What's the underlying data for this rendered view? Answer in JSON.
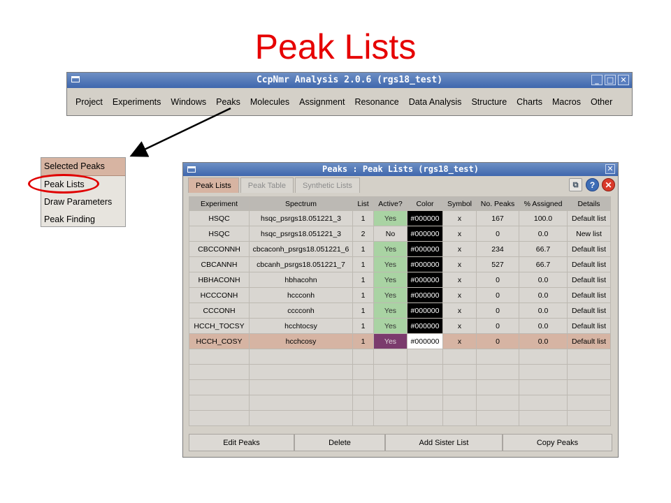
{
  "slide": {
    "title": "Peak Lists"
  },
  "main_window": {
    "title": "CcpNmr Analysis 2.0.6 (rgs18_test)",
    "menu": [
      "Project",
      "Experiments",
      "Windows",
      "Peaks",
      "Molecules",
      "Assignment",
      "Resonance",
      "Data Analysis",
      "Structure",
      "Charts",
      "Macros",
      "Other"
    ]
  },
  "peaks_menu": {
    "items": [
      "Selected Peaks",
      "Peak Lists",
      "Draw Parameters",
      "Peak Finding"
    ],
    "selected": "Selected Peaks",
    "circled": "Peak Lists"
  },
  "peaks_window": {
    "title": "Peaks : Peak Lists (rgs18_test)",
    "tabs": [
      "Peak Lists",
      "Peak Table",
      "Synthetic Lists"
    ],
    "active_tab": "Peak Lists",
    "columns": [
      "Experiment",
      "Spectrum",
      "List",
      "Active?",
      "Color",
      "Symbol",
      "No. Peaks",
      "% Assigned",
      "Details"
    ],
    "rows": [
      [
        "HSQC",
        "hsqc_psrgs18.051221_3",
        "1",
        "Yes",
        "#000000",
        "x",
        "167",
        "100.0",
        "Default list"
      ],
      [
        "HSQC",
        "hsqc_psrgs18.051221_3",
        "2",
        "No",
        "#000000",
        "x",
        "0",
        "0.0",
        "New list"
      ],
      [
        "CBCCONNH",
        "cbcaconh_psrgs18.051221_6",
        "1",
        "Yes",
        "#000000",
        "x",
        "234",
        "66.7",
        "Default list"
      ],
      [
        "CBCANNH",
        "cbcanh_psrgs18.051221_7",
        "1",
        "Yes",
        "#000000",
        "x",
        "527",
        "66.7",
        "Default list"
      ],
      [
        "HBHACONH",
        "hbhacohn",
        "1",
        "Yes",
        "#000000",
        "x",
        "0",
        "0.0",
        "Default list"
      ],
      [
        "HCCCONH",
        "hccconh",
        "1",
        "Yes",
        "#000000",
        "x",
        "0",
        "0.0",
        "Default list"
      ],
      [
        "CCCONH",
        "cccconh",
        "1",
        "Yes",
        "#000000",
        "x",
        "0",
        "0.0",
        "Default list"
      ],
      [
        "HCCH_TOCSY",
        "hcchtocsy",
        "1",
        "Yes",
        "#000000",
        "x",
        "0",
        "0.0",
        "Default list"
      ],
      [
        "HCCH_COSY",
        "hcchcosy",
        "1",
        "Yes",
        "#000000",
        "x",
        "0",
        "0.0",
        "Default list"
      ]
    ],
    "highlighted_row": 8,
    "buttons": [
      "Edit Peaks",
      "Delete",
      "Add Sister List",
      "Copy Peaks"
    ]
  },
  "colors": {
    "title_red": "#e60000",
    "titlebar_blue": "#3f67ad",
    "selection_tan": "#d7b4a2",
    "active_green": "#a9d3a3"
  }
}
